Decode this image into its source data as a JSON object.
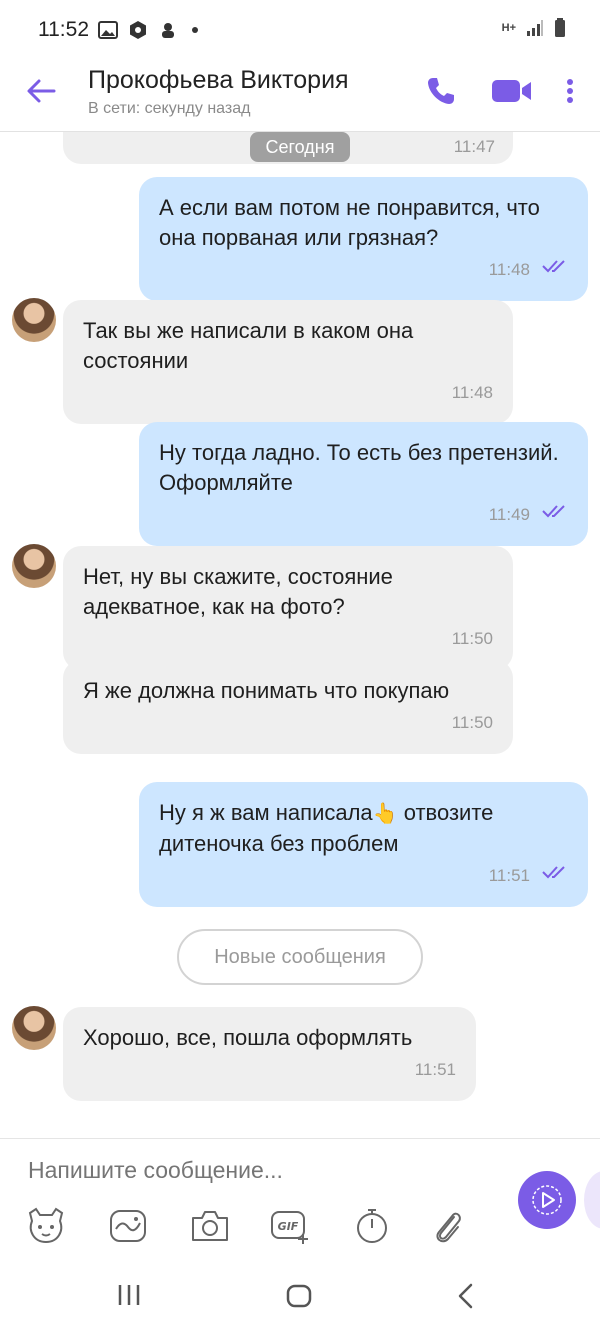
{
  "status_bar": {
    "time": "11:52",
    "network": "H+"
  },
  "header": {
    "contact_name": "Прокофьева Виктория",
    "contact_status": "В сети: секунду назад"
  },
  "chat": {
    "previous_time": "11:47",
    "date_divider": "Сегодня",
    "messages": [
      {
        "direction": "out",
        "text": "А если вам потом не понравится, что она порваная или грязная?",
        "time": "11:48"
      },
      {
        "direction": "in",
        "text": "Так вы же написали в каком она состоянии",
        "time": "11:48"
      },
      {
        "direction": "out",
        "text": "Ну тогда ладно. То есть без претензий. Оформляйте",
        "time": "11:49"
      },
      {
        "direction": "in",
        "text": "Нет, ну вы скажите, состояние адекватное, как на фото?",
        "time": "11:50"
      },
      {
        "direction": "in",
        "text": "Я же должна понимать что покупаю",
        "time": "11:50"
      },
      {
        "direction": "out",
        "text_before": "Ну я ж вам написала",
        "emoji": "👆",
        "text_after": "отвозите дитеночка без проблем",
        "time": "11:51"
      },
      {
        "direction": "in",
        "text": "Хорошо, все, пошла оформлять",
        "time": "11:51"
      }
    ],
    "new_messages_label": "Новые сообщения"
  },
  "input": {
    "placeholder": "Напишите сообщение..."
  },
  "colors": {
    "accent": "#7b5ce6",
    "outgoing_bubble": "#cde6ff",
    "incoming_bubble": "#efefef"
  },
  "icons": [
    "back-arrow-icon",
    "phone-icon",
    "video-camera-icon",
    "more-vert-icon",
    "sticker-icon",
    "doodle-icon",
    "camera-icon",
    "gif-icon",
    "timer-icon",
    "paperclip-icon",
    "send-icon"
  ]
}
